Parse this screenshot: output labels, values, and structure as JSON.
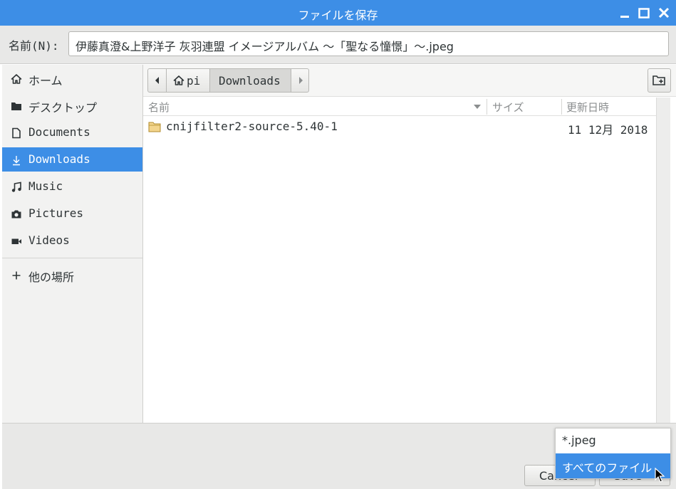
{
  "window": {
    "title": "ファイルを保存",
    "controls": [
      "minimize",
      "maximize",
      "close"
    ]
  },
  "name_row": {
    "label": "名前(N):",
    "value": "伊藤真澄&上野洋子 灰羽連盟 イメージアルバム 〜「聖なる憧憬」〜.jpeg"
  },
  "sidebar": {
    "items": [
      {
        "label": "ホーム",
        "icon": "home-icon"
      },
      {
        "label": "デスクトップ",
        "icon": "folder-icon"
      },
      {
        "label": "Documents",
        "icon": "document-icon"
      },
      {
        "label": "Downloads",
        "icon": "download-icon",
        "selected": true
      },
      {
        "label": "Music",
        "icon": "music-icon"
      },
      {
        "label": "Pictures",
        "icon": "camera-icon"
      },
      {
        "label": "Videos",
        "icon": "video-icon"
      },
      {
        "label": "他の場所",
        "icon": "plus-icon"
      }
    ]
  },
  "pathbar": {
    "segments": [
      "pi",
      "Downloads"
    ]
  },
  "columns": {
    "name": "名前",
    "size": "サイズ",
    "modified": "更新日時"
  },
  "files": [
    {
      "name": "cnijfilter2-source-5.40-1",
      "size": "",
      "modified": "11 12月 2018",
      "icon": "folder-icon"
    }
  ],
  "buttons": {
    "cancel": "Cancel",
    "save": "Save"
  },
  "filter_dropdown": {
    "options": [
      "*.jpeg",
      "すべてのファイル"
    ],
    "highlighted_index": 1
  },
  "colors": {
    "accent": "#3d8ee6",
    "window_bg": "#e8e8e7",
    "sidebar_bg": "#f2f2f1"
  }
}
